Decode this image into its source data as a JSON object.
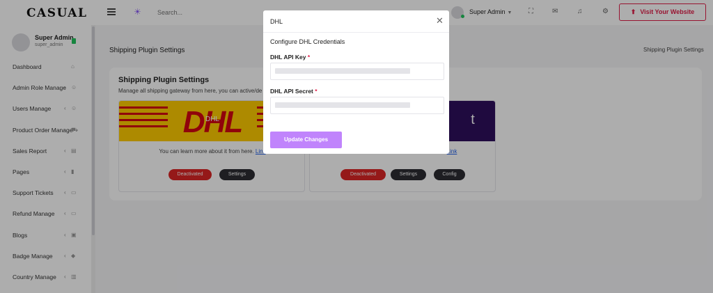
{
  "brand": {
    "logo": "CASUAL"
  },
  "topbar": {
    "search_placeholder": "Search...",
    "user_name": "Super Admin",
    "visit_label": "Visit Your Website"
  },
  "sidebar": {
    "user_name": "Super Admin",
    "user_role": "super_admin",
    "items": [
      {
        "label": "Dashboard",
        "icon": "home-icon",
        "has_children": false
      },
      {
        "label": "Admin Role Manage",
        "icon": "users-icon",
        "has_children": true
      },
      {
        "label": "Users Manage",
        "icon": "users-icon",
        "has_children": true
      },
      {
        "label": "Product Order Manage",
        "icon": "cart-icon",
        "has_children": true
      },
      {
        "label": "Sales Report",
        "icon": "chart-icon",
        "has_children": true
      },
      {
        "label": "Pages",
        "icon": "file-icon",
        "has_children": true
      },
      {
        "label": "Support Tickets",
        "icon": "folder-icon",
        "has_children": true
      },
      {
        "label": "Refund Manage",
        "icon": "folder-icon",
        "has_children": true
      },
      {
        "label": "Blogs",
        "icon": "blog-icon",
        "has_children": true
      },
      {
        "label": "Badge Manage",
        "icon": "badge-icon",
        "has_children": true
      },
      {
        "label": "Country Manage",
        "icon": "map-icon",
        "has_children": true
      }
    ]
  },
  "page": {
    "title": "Shipping Plugin Settings",
    "breadcrumb": "Shipping Plugin Settings",
    "card_title": "Shipping Plugin Settings",
    "card_subtitle": "Manage all shipping gateway from here, you can active/de"
  },
  "plugins": [
    {
      "name": "DHL",
      "banner_color": "#ffcc00",
      "desc": "You can learn more about it from here.",
      "link": "Link",
      "status": "Deactivated",
      "settings": "Settings"
    },
    {
      "name": "t",
      "banner_color": "#2e0f5e",
      "desc": "",
      "link": "Link",
      "status": "Deactivated",
      "settings": "Settings",
      "config": "Config"
    }
  ],
  "modal": {
    "title": "DHL",
    "subtitle": "Configure DHL Credentials",
    "api_key_label": "DHL API Key",
    "api_secret_label": "DHL API Secret",
    "required_mark": "*",
    "submit_label": "Update Changes"
  },
  "colors": {
    "accent": "#c084fc",
    "danger": "#dc2626",
    "brand_red": "#e11d48",
    "dhl_yellow": "#ffcc00",
    "dhl_red": "#d40511"
  }
}
